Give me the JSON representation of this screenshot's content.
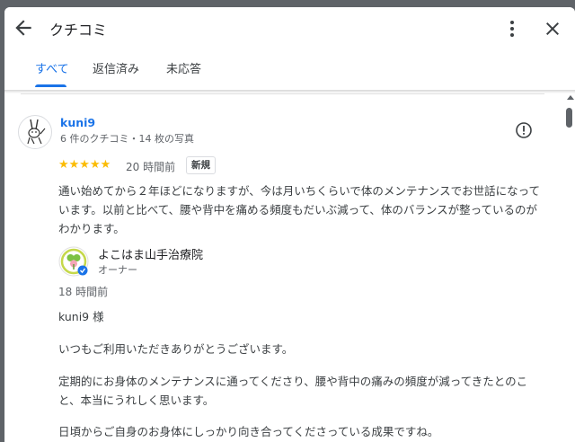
{
  "header": {
    "title": "クチコミ",
    "tabs": [
      {
        "label": "すべて",
        "active": true
      },
      {
        "label": "返信済み",
        "active": false
      },
      {
        "label": "未応答",
        "active": false
      }
    ]
  },
  "review": {
    "reviewer": "kuni9",
    "meta": "6 件のクチコミ・14 枚の写真",
    "stars": "★★★★★",
    "rating": 5,
    "time": "20 時間前",
    "badge": "新規",
    "text": "通い始めてから２年ほどになりますが、今は月いちくらいで体のメンテナンスでお世話になっています。以前と比べて、腰や背中を痛める頻度もだいぶ減って、体のバランスが整っているのがわかります。"
  },
  "reply": {
    "owner_name": "よこはま山手治療院",
    "owner_role": "オーナー",
    "time": "18 時間前",
    "lines": [
      "kuni9 様",
      "いつもご利用いただきありがとうございます。",
      "定期的にお身体のメンテナンスに通ってくださり、腰や背中の痛みの頻度が減ってきたとのこと、本当にうれしく思います。",
      "日頃からご自身のお身体にしっかり向き合ってくださっている成果ですね。"
    ]
  },
  "colors": {
    "accent": "#1a73e8",
    "star": "#fbbc04",
    "text": "#3c4043",
    "muted": "#5f6368"
  }
}
